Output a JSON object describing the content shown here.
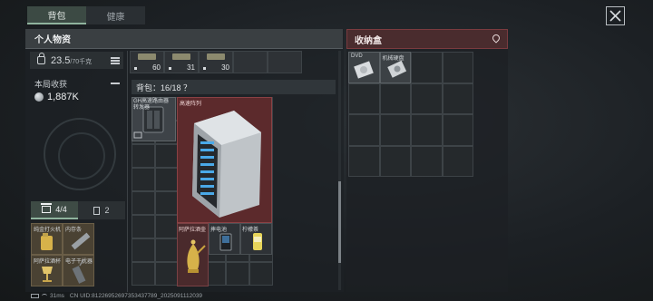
{
  "tabs": [
    {
      "label": "背包",
      "active": true
    },
    {
      "label": "健康",
      "active": false
    }
  ],
  "personal": {
    "title": "个人物资",
    "weight_value": "23.5",
    "weight_unit": "/70千克",
    "earnings_label": "本局收获",
    "earnings_value": "1,887K"
  },
  "left_tabs": [
    {
      "label": "4/4",
      "icon": "box-icon",
      "active": true
    },
    {
      "label": "2",
      "icon": "cabinet-icon",
      "active": false
    }
  ],
  "left_items": [
    {
      "label": "纯金打火机"
    },
    {
      "label": "内存条"
    },
    {
      "label": "阿萨拉酒杯"
    },
    {
      "label": "电子干扰器"
    }
  ],
  "equipment_counts": [
    "60",
    "31",
    "30"
  ],
  "bag": {
    "label": "背包：16/18 ？",
    "items": [
      {
        "label": "GH高速路由器",
        "name_line2": "转发器"
      },
      {
        "label": "高速阵列"
      },
      {
        "label": "阿萨拉酒壶"
      },
      {
        "label": "摔电池"
      },
      {
        "label": "柠檬茶"
      }
    ]
  },
  "storage": {
    "title": "收纳盒",
    "items": [
      {
        "label": "DVD"
      },
      {
        "label": "机械硬盘"
      }
    ]
  },
  "status": {
    "ping": "31ms",
    "uid_text": "CN UID:8122695269735343778​9_2025091112039"
  },
  "colors": {
    "accent_green": "#8fb39d",
    "storage_red": "#7a3b3f",
    "rack_highlight": "#5c2a2c"
  }
}
